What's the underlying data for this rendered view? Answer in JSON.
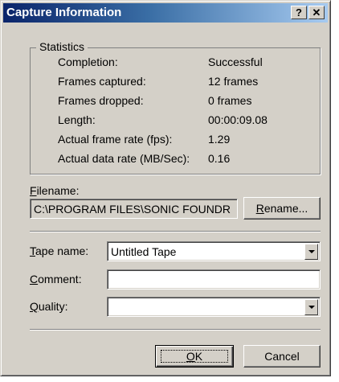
{
  "window": {
    "title": "Capture Information",
    "help_glyph": "?",
    "close_glyph": "✕"
  },
  "statistics": {
    "legend": "Statistics",
    "rows": [
      {
        "label": "Completion:",
        "value": "Successful"
      },
      {
        "label": "Frames captured:",
        "value": "12 frames"
      },
      {
        "label": "Frames dropped:",
        "value": "0 frames"
      },
      {
        "label": "Length:",
        "value": "00:00:09.08"
      },
      {
        "label": "Actual frame rate (fps):",
        "value": "1.29"
      },
      {
        "label": "Actual data rate (MB/Sec):",
        "value": "0.16"
      }
    ]
  },
  "filename": {
    "label_mnemonic": "F",
    "label_rest": "ilename:",
    "value": "C:\\PROGRAM FILES\\SONIC FOUNDR",
    "rename_mnemonic": "R",
    "rename_rest": "ename..."
  },
  "form": {
    "tape_name": {
      "label_mnemonic": "T",
      "label_rest": "ape name:",
      "value": "Untitled Tape"
    },
    "comment": {
      "label_mnemonic": "C",
      "label_rest": "omment:",
      "value": ""
    },
    "quality": {
      "label_mnemonic": "Q",
      "label_rest": "uality:",
      "value": ""
    }
  },
  "buttons": {
    "ok_mnemonic": "O",
    "ok_rest": "K",
    "cancel": "Cancel"
  },
  "colors": {
    "title_gradient_start": "#0a246a",
    "title_gradient_end": "#a6caf0",
    "face": "#d4d0c8"
  }
}
